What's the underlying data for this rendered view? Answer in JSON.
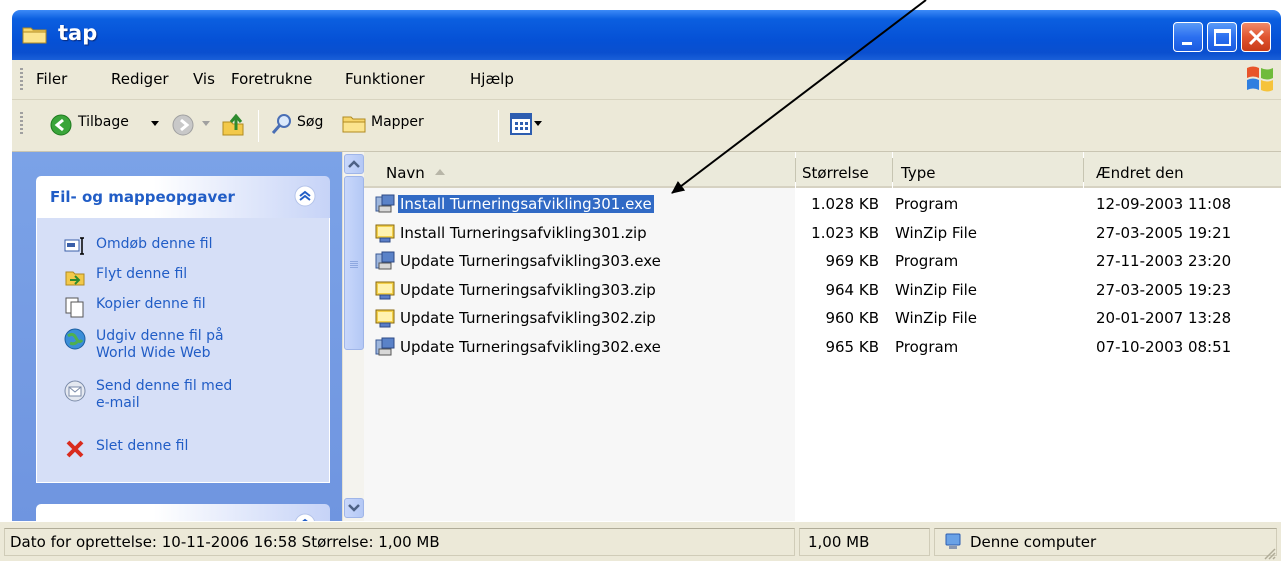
{
  "window": {
    "title": "tap",
    "buttons": [
      "minimize",
      "maximize",
      "close"
    ]
  },
  "menubar": {
    "items": [
      {
        "label": "Filer",
        "icon": ""
      },
      {
        "label": "Rediger"
      },
      {
        "label": "Vis"
      },
      {
        "label": "Foretrukne"
      },
      {
        "label": "Funktioner"
      },
      {
        "label": "Hjælp"
      }
    ]
  },
  "toolbar": {
    "back_label": "Tilbage",
    "search_label": "Søg",
    "folders_label": "Mapper"
  },
  "taskpane": {
    "header": "Fil- og mappeopgaver",
    "tasks": [
      {
        "label": "Omdøb denne fil",
        "icon": "rename-icon"
      },
      {
        "label": "Flyt denne fil",
        "icon": "move-icon"
      },
      {
        "label": "Kopier denne fil",
        "icon": "copy-icon"
      },
      {
        "label": "Udgiv denne fil på World Wide Web",
        "line1": "Udgiv denne fil på",
        "line2": "World Wide Web",
        "icon": "globe-icon"
      },
      {
        "label": "Send denne fil med e-mail",
        "line1": "Send denne fil med",
        "line2": "e-mail",
        "icon": "mail-icon"
      },
      {
        "label": "Slet denne fil",
        "icon": "delete-icon"
      }
    ]
  },
  "filelist": {
    "columns": [
      "Navn",
      "Størrelse",
      "Type",
      "Ændret den"
    ],
    "sort_column": "Navn",
    "rows": [
      {
        "name": "Install Turneringsafvikling301.exe",
        "size": "1.028 KB",
        "type": "Program",
        "modified": "12-09-2003 11:08",
        "kind": "exe",
        "selected": true
      },
      {
        "name": "Install Turneringsafvikling301.zip",
        "size": "1.023 KB",
        "type": "WinZip File",
        "modified": "27-03-2005 19:21",
        "kind": "zip"
      },
      {
        "name": "Update Turneringsafvikling303.exe",
        "size": "969 KB",
        "type": "Program",
        "modified": "27-11-2003 23:20",
        "kind": "exe"
      },
      {
        "name": "Update Turneringsafvikling303.zip",
        "size": "964 KB",
        "type": "WinZip File",
        "modified": "27-03-2005 19:23",
        "kind": "zip"
      },
      {
        "name": "Update Turneringsafvikling302.zip",
        "size": "960 KB",
        "type": "WinZip File",
        "modified": "20-01-2007 13:28",
        "kind": "zip"
      },
      {
        "name": "Update Turneringsafvikling302.exe",
        "size": "965 KB",
        "type": "Program",
        "modified": "07-10-2003 08:51",
        "kind": "exe"
      }
    ]
  },
  "statusbar": {
    "details": "Dato for oprettelse: 10-11-2006 16:58 Størrelse: 1,00 MB",
    "size": "1,00 MB",
    "location": "Denne computer"
  },
  "colors": {
    "titlebar": "#0551d6",
    "selection": "#316ac5",
    "taskpane": "#6f95e0",
    "link": "#215dc6"
  }
}
